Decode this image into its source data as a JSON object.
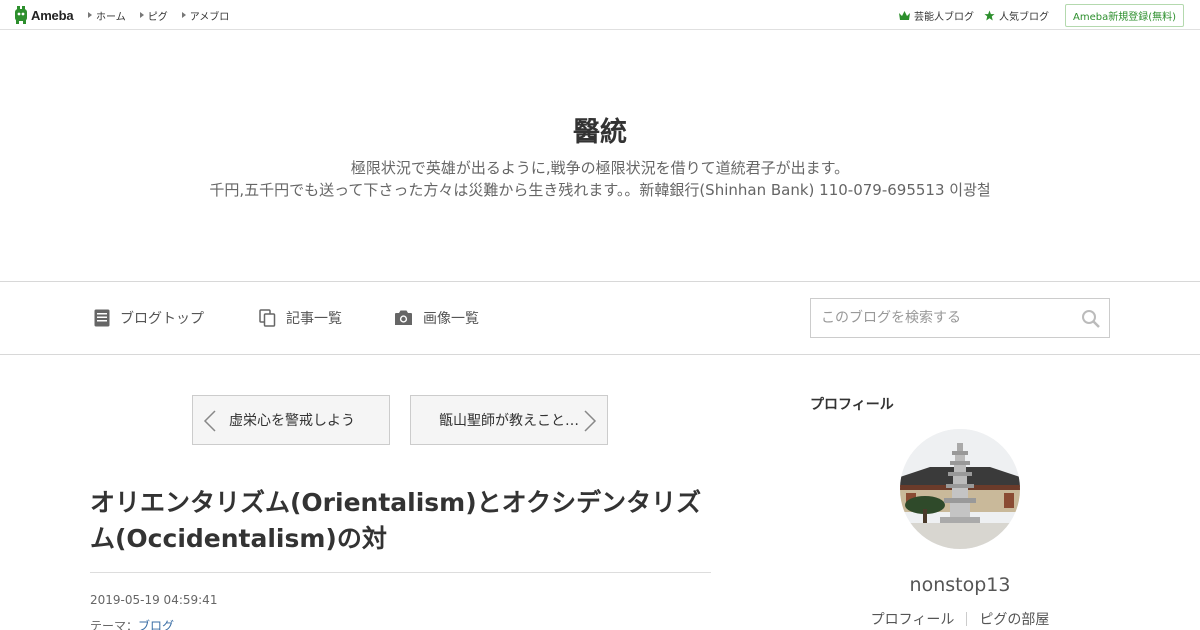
{
  "topbar": {
    "logo_text": "Ameba",
    "nav": [
      "ホーム",
      "ピグ",
      "アメブロ"
    ],
    "right": {
      "celebrity_blog": "芸能人ブログ",
      "popular_blog": "人気ブログ",
      "register": "Ameba新規登録(無料)"
    }
  },
  "header": {
    "title": "醫統",
    "desc_line1": "極限状況で英雄が出るように,戦争の極限状況を借りて道統君子が出ます。",
    "desc_line2": "千円,五千円でも送って下さった方々は災難から生き残れます。。新韓銀行(Shinhan Bank) 110-079-695513 이광철"
  },
  "nav": {
    "blog_top": "ブログトップ",
    "articles": "記事一覧",
    "images": "画像一覧",
    "search_placeholder": "このブログを検索する"
  },
  "pager": {
    "prev": "虚栄心を警戒しよう",
    "next": "甑山聖師が教えこと…"
  },
  "article": {
    "title": "オリエンタリズム(Orientalism)とオクシデンタリズム(Occidentalism)の対",
    "date": "2019-05-19 04:59:41",
    "theme_label": "テーマ：",
    "theme": "ブログ"
  },
  "sidebar": {
    "heading": "プロフィール",
    "name": "nonstop13",
    "links": [
      "プロフィール",
      "ピグの部屋"
    ]
  },
  "colors": {
    "brand_green": "#2d8f2d",
    "link_blue": "#3a6ea5"
  }
}
